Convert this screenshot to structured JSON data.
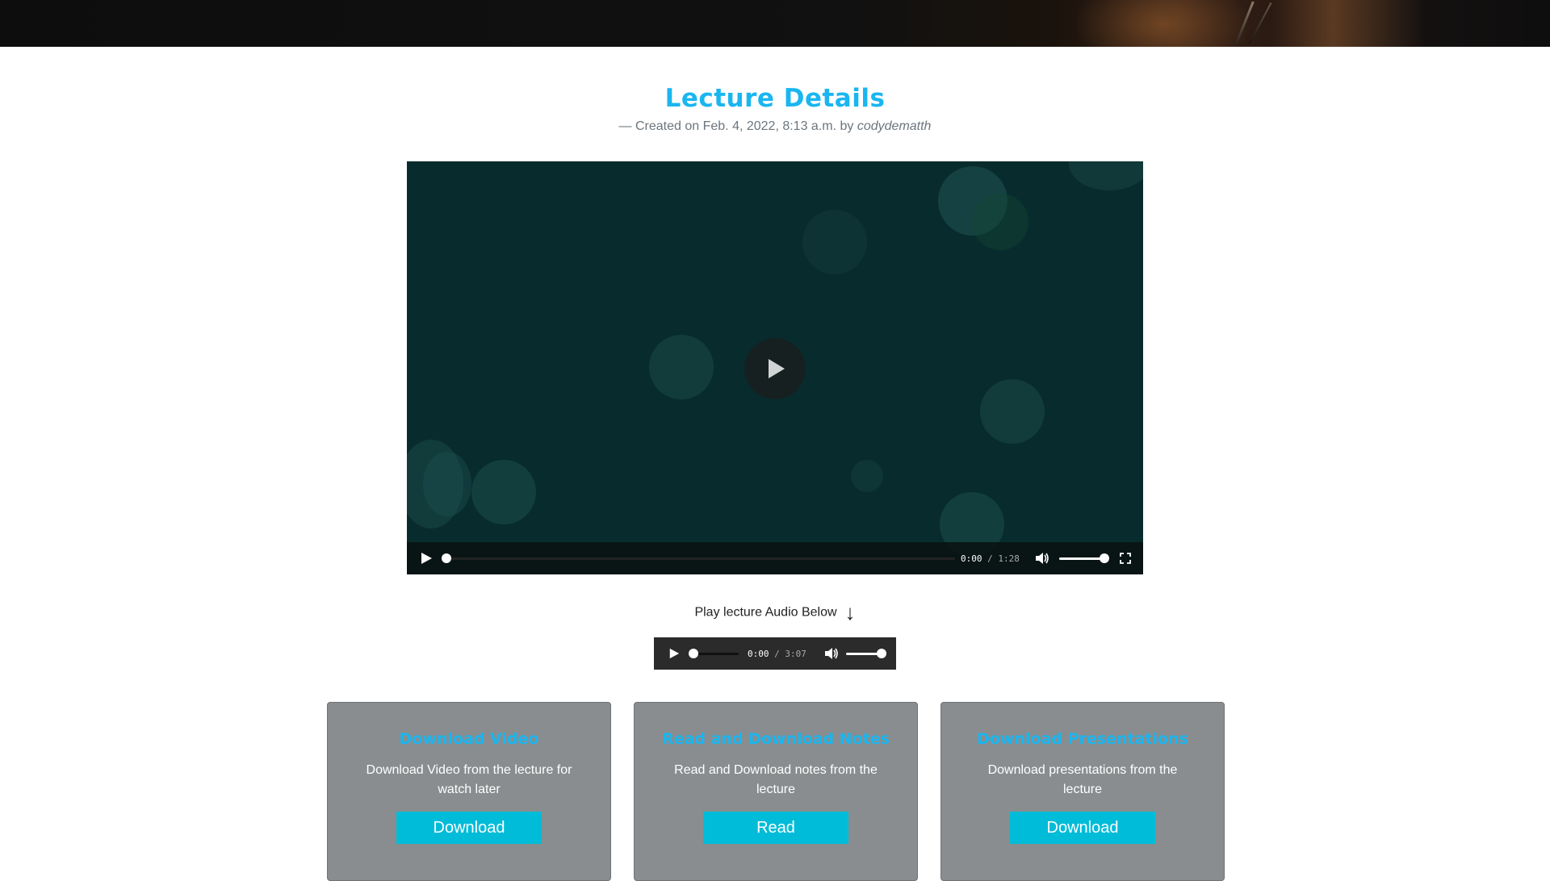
{
  "header": {
    "title": "Lecture Details",
    "meta_prefix": "— Created on Feb. 4, 2022, 8:13 a.m. by",
    "author": "codydematth"
  },
  "video_player": {
    "current_time": "0:00",
    "separator": "/",
    "duration": "1:28",
    "progress": 0,
    "volume": 1.0,
    "icons": [
      "play-icon",
      "volume-icon",
      "fullscreen-icon"
    ]
  },
  "audio": {
    "label": "Play lecture Audio Below",
    "arrow": "↓",
    "current_time": "0:00",
    "separator": "/",
    "duration": "3:07",
    "progress": 0,
    "volume": 1.0
  },
  "cards": [
    {
      "title": "Download Video",
      "description": "Download Video from the lecture for watch later",
      "button": "Download"
    },
    {
      "title": "Read and Download Notes",
      "description": "Read and Download notes from the lecture",
      "button": "Read"
    },
    {
      "title": "Download Presentations",
      "description": "Download presentations from the lecture",
      "button": "Download"
    }
  ],
  "colors": {
    "accent": "#1ab6f0",
    "button": "#00bcd8",
    "card_bg": "#898d8f",
    "video_bg": "#082c2d"
  }
}
